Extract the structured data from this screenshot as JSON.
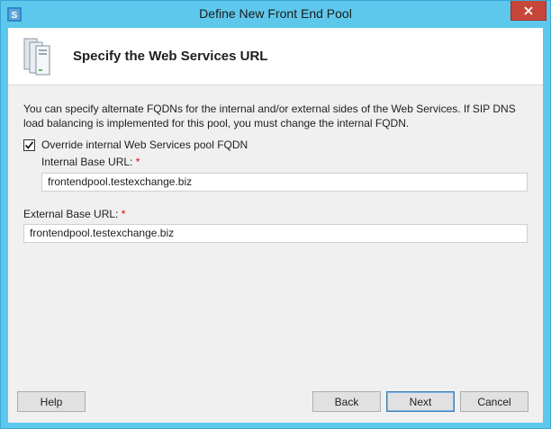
{
  "window": {
    "title": "Define New Front End Pool"
  },
  "header": {
    "title": "Specify the Web Services URL"
  },
  "description": "You can specify alternate FQDNs for the internal and/or external sides of the Web Services.  If SIP DNS load balancing is implemented for this pool, you must change the internal FQDN.",
  "override": {
    "label": "Override internal Web Services pool FQDN",
    "checked": true
  },
  "internal": {
    "label": "Internal Base URL:",
    "required": "*",
    "value": "frontendpool.testexchange.biz"
  },
  "external": {
    "label": "External Base URL:",
    "required": "*",
    "value": "frontendpool.testexchange.biz"
  },
  "buttons": {
    "help": "Help",
    "back": "Back",
    "next": "Next",
    "cancel": "Cancel"
  },
  "colors": {
    "titlebar": "#5ec8ec",
    "close": "#c7463a",
    "required": "#e00000"
  }
}
